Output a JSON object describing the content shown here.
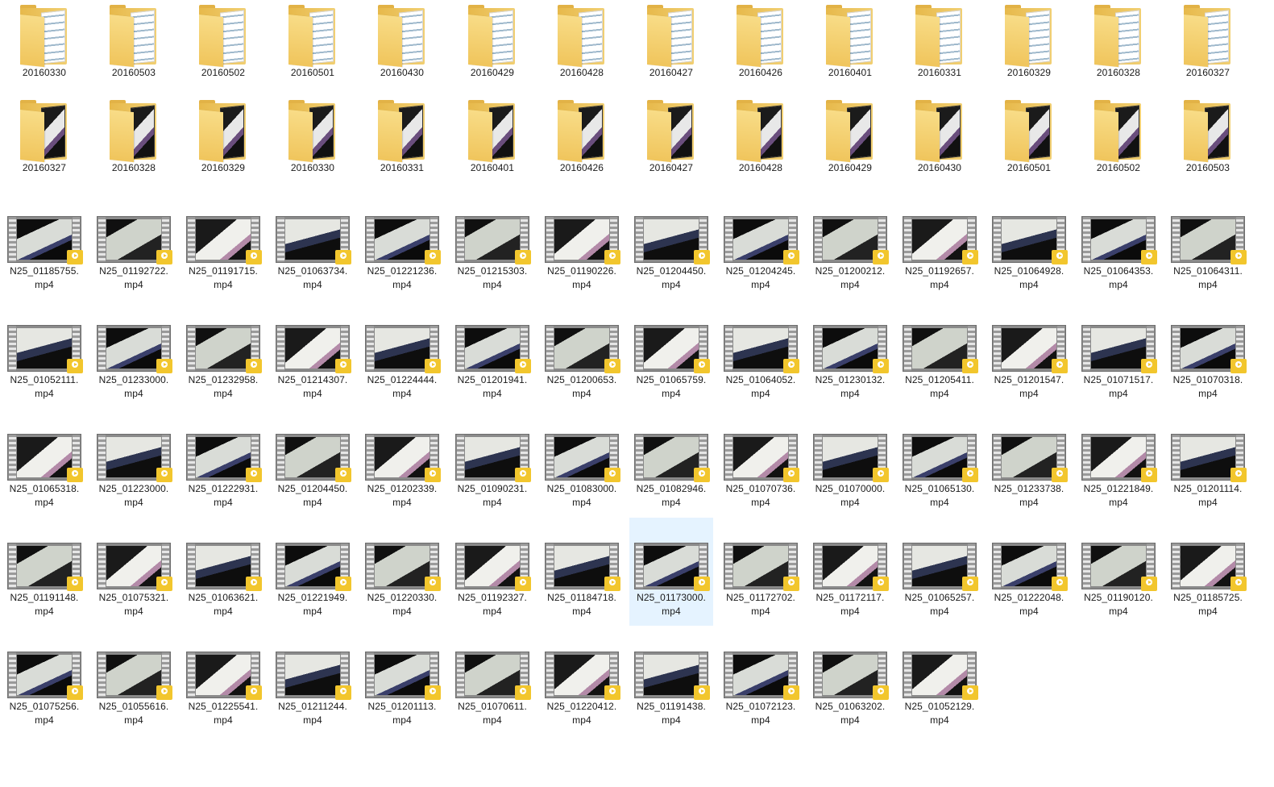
{
  "folders_row1": [
    "20160330",
    "20160503",
    "20160502",
    "20160501",
    "20160430",
    "20160429",
    "20160428",
    "20160427",
    "20160426",
    "20160401",
    "20160331",
    "20160329",
    "20160328",
    "20160327"
  ],
  "folders_row2": [
    "20160327",
    "20160328",
    "20160329",
    "20160330",
    "20160331",
    "20160401",
    "20160426",
    "20160427",
    "20160428",
    "20160429",
    "20160430",
    "20160501",
    "20160502",
    "20160503"
  ],
  "video_ext": "mp4",
  "badge_text": "Player",
  "video_rows": [
    [
      "N25_01185755.",
      "N25_01192722.",
      "N25_01191715.",
      "N25_01063734.",
      "N25_01221236.",
      "N25_01215303.",
      "N25_01190226.",
      "N25_01204450.",
      "N25_01204245.",
      "N25_01200212.",
      "N25_01192657.",
      "N25_01064928.",
      "N25_01064353.",
      "N25_01064311."
    ],
    [
      "N25_01052111.",
      "N25_01233000.",
      "N25_01232958.",
      "N25_01214307.",
      "N25_01224444.",
      "N25_01201941.",
      "N25_01200653.",
      "N25_01065759.",
      "N25_01064052.",
      "N25_01230132.",
      "N25_01205411.",
      "N25_01201547.",
      "N25_01071517.",
      "N25_01070318."
    ],
    [
      "N25_01065318.",
      "N25_01223000.",
      "N25_01222931.",
      "N25_01204450.",
      "N25_01202339.",
      "N25_01090231.",
      "N25_01083000.",
      "N25_01082946.",
      "N25_01070736.",
      "N25_01070000.",
      "N25_01065130.",
      "N25_01233738.",
      "N25_01221849.",
      "N25_01201114."
    ],
    [
      "N25_01191148.",
      "N25_01075321.",
      "N25_01063621.",
      "N25_01221949.",
      "N25_01220330.",
      "N25_01192327.",
      "N25_01184718.",
      "N25_01173000.",
      "N25_01172702.",
      "N25_01172117.",
      "N25_01065257.",
      "N25_01222048.",
      "N25_01190120.",
      "N25_01185725."
    ],
    [
      "N25_01075256.",
      "N25_01055616.",
      "N25_01225541.",
      "N25_01211244.",
      "N25_01201113.",
      "N25_01070611.",
      "N25_01220412.",
      "N25_01191438.",
      "N25_01072123.",
      "N25_01063202.",
      "N25_01052129."
    ]
  ],
  "selected_item": "N25_01173000.",
  "colors": {
    "selection": "#e5f3ff",
    "folder": "#f0c55c",
    "badge": "#f2c62d"
  }
}
